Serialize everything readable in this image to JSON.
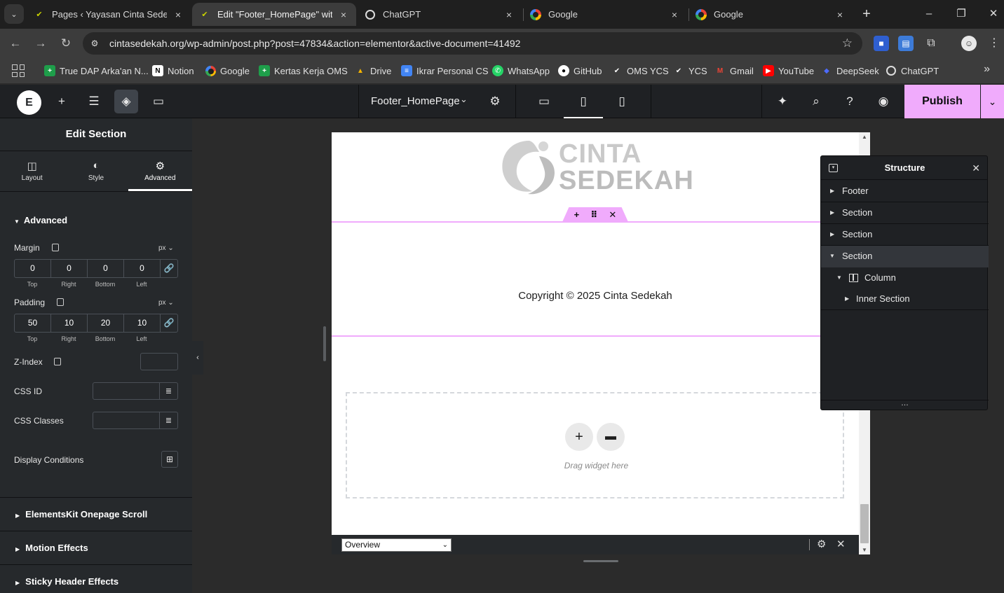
{
  "browser": {
    "tabs": [
      {
        "title": "Pages ‹ Yayasan Cinta Sedekah",
        "icon": "ycs-icon"
      },
      {
        "title": "Edit \"Footer_HomePage\" with E",
        "icon": "ycs-icon",
        "active": true
      },
      {
        "title": "ChatGPT",
        "icon": "chatgpt-icon"
      },
      {
        "title": "Google",
        "icon": "google-icon"
      },
      {
        "title": "Google",
        "icon": "google-icon"
      }
    ],
    "url": "cintasedekah.org/wp-admin/post.php?post=47834&action=elementor&active-document=41492",
    "bookmarks": [
      "True DAP Arka'an N...",
      "Notion",
      "Google",
      "Kertas Kerja OMS",
      "Drive",
      "Ikrar Personal CS",
      "WhatsApp",
      "GitHub",
      "OMS YCS",
      "YCS",
      "Gmail",
      "YouTube",
      "DeepSeek",
      "ChatGPT"
    ]
  },
  "elementor": {
    "logo": "E",
    "document_title": "Footer_HomePage",
    "publish_label": "Publish",
    "accent_color": "#f0abfc"
  },
  "panel": {
    "title": "Edit Section",
    "tabs": [
      "Layout",
      "Style",
      "Advanced"
    ],
    "active_tab": "Advanced",
    "section_title": "Advanced",
    "margin": {
      "label": "Margin",
      "unit": "px",
      "values": [
        "0",
        "0",
        "0",
        "0"
      ]
    },
    "padding": {
      "label": "Padding",
      "unit": "px",
      "values": [
        "50",
        "10",
        "20",
        "10"
      ]
    },
    "dim_labels": [
      "Top",
      "Right",
      "Bottom",
      "Left"
    ],
    "z_index_label": "Z-Index",
    "css_id_label": "CSS ID",
    "css_classes_label": "CSS Classes",
    "display_conditions_label": "Display Conditions",
    "accordions": [
      "ElementsKit Onepage Scroll",
      "Motion Effects",
      "Sticky Header Effects"
    ]
  },
  "canvas": {
    "logo_line1": "CINTA",
    "logo_line2": "SEDEKAH",
    "copyright": "Copyright © 2025 Cinta Sedekah",
    "drop_label": "Drag widget here",
    "navigator_select": "Overview"
  },
  "structure": {
    "title": "Structure",
    "items": [
      {
        "label": "Footer"
      },
      {
        "label": "Section"
      },
      {
        "label": "Section"
      },
      {
        "label": "Section",
        "expanded": true,
        "selected": true
      },
      {
        "label": "Column",
        "expanded": true
      },
      {
        "label": "Inner Section"
      }
    ]
  }
}
